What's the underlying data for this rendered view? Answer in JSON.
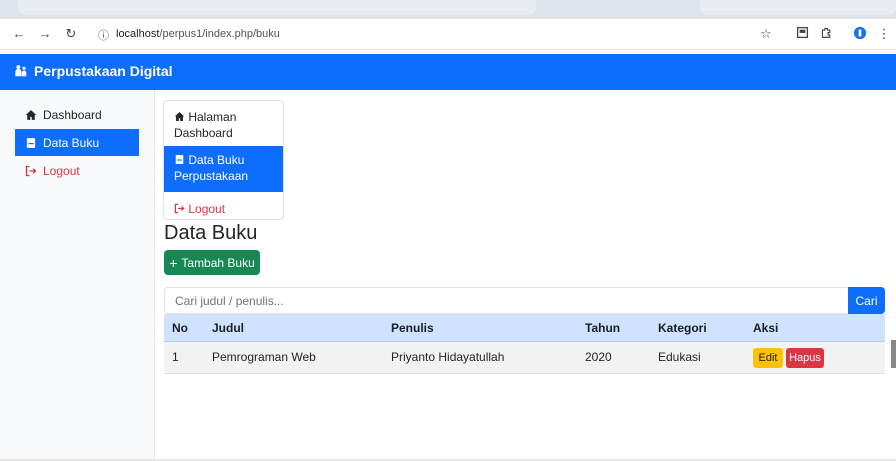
{
  "browser": {
    "url_host": "localhost",
    "url_path": "/perpus1/index.php/buku"
  },
  "app": {
    "brand": "Perpustakaan Digital"
  },
  "sidebar": {
    "items": [
      {
        "label": "Dashboard",
        "icon": "home-icon",
        "active": false
      },
      {
        "label": "Data Buku",
        "icon": "book-icon",
        "active": true
      },
      {
        "label": "Logout",
        "icon": "logout-icon",
        "active": false
      }
    ]
  },
  "listgroup": {
    "items": [
      {
        "line1": "Halaman",
        "line2": "Dashboard",
        "icon": "home-icon"
      },
      {
        "line1": "Data Buku",
        "line2": "Perpustakaan",
        "icon": "book-icon"
      },
      {
        "line1": "Logout",
        "line2": "",
        "icon": "logout-icon"
      }
    ]
  },
  "main": {
    "title": "Data Buku",
    "add_button": "Tambah Buku",
    "search_placeholder": "Cari judul / penulis...",
    "search_button": "Cari"
  },
  "table": {
    "headers": [
      "No",
      "Judul",
      "Penulis",
      "Tahun",
      "Kategori",
      "Aksi"
    ],
    "rows": [
      {
        "no": "1",
        "judul": "Pemrograman Web",
        "penulis": "Priyanto Hidayatullah",
        "tahun": "2020",
        "kategori": "Edukasi",
        "edit": "Edit",
        "hapus": "Hapus"
      }
    ]
  },
  "colors": {
    "primary": "#0d6efd",
    "success": "#198754",
    "warning": "#ffc107",
    "danger": "#dc3545",
    "table_head": "#cfe2ff"
  }
}
